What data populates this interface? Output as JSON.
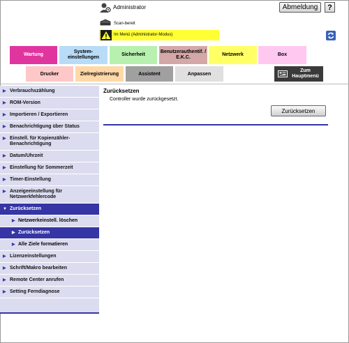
{
  "header": {
    "user_label": "Administrator",
    "logout_label": "Abmeldung",
    "help_label": "?",
    "scan_status": "Scan-bereit",
    "mode_label": "Im Menü (Administrator-Modus)"
  },
  "tabs_top": [
    {
      "label": "Wartung",
      "color": "#e0359f"
    },
    {
      "label": "System-\neinstellungen",
      "color": "#b8dcf8"
    },
    {
      "label": "Sicherheit",
      "color": "#b8f0b0"
    },
    {
      "label": "Benutzerauthentif. /\nE.K.C.",
      "color": "#d4a8a8"
    },
    {
      "label": "Netzwerk",
      "color": "#ffff66"
    },
    {
      "label": "Box",
      "color": "#ffc8f0"
    }
  ],
  "tabs_sub": [
    {
      "label": "Drucker",
      "color": "#ffc8c8"
    },
    {
      "label": "Zielregistrierung",
      "color": "#ffd8a8"
    },
    {
      "label": "Assistent",
      "color": "#a0a0a0"
    },
    {
      "label": "Anpassen",
      "color": "#e0e0e0"
    }
  ],
  "home_label": "Zum\nHauptmenü",
  "sidebar": {
    "items": [
      "Verbrauchszählung",
      "ROM-Version",
      "Importieren / Exportieren",
      "Benachrichtigung über Status",
      "Einstell. für Kopienzähler-\nBenachrichtigung",
      "Datum/Uhrzeit",
      "Einstellung für Sommerzeit",
      "Timer-Einstellung",
      "Anzeigeeinstellung für\nNetzwerkfehlercode",
      "Zurücksetzen",
      "Lizenzeinstellungen",
      "Schrift/Makro bearbeiten",
      "Remote Center anrufen",
      "Setting Ferndiagnose"
    ],
    "sub_items": [
      "Netzwerkeinstell. löschen",
      "Zurücksetzen",
      "Alle Ziele formatieren"
    ]
  },
  "main": {
    "title": "Zurücksetzen",
    "message": "Controller wurde zurückgesetzt.",
    "button_label": "Zurücksetzen"
  }
}
